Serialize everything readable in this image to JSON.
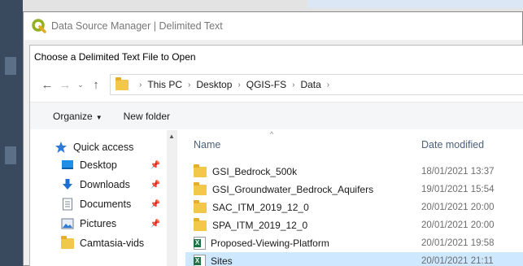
{
  "qgis_dialog": {
    "title": "Data Source Manager | Delimited Text"
  },
  "file_dialog": {
    "title": "Choose a Delimited Text File to Open",
    "breadcrumbs": [
      "This PC",
      "Desktop",
      "QGIS-FS",
      "Data"
    ],
    "toolbar": {
      "organize_label": "Organize",
      "new_folder_label": "New folder"
    },
    "nav_pane": {
      "items": [
        {
          "label": "Quick access",
          "icon": "star-icon"
        },
        {
          "label": "Desktop",
          "icon": "desktop-icon",
          "pinned": true
        },
        {
          "label": "Downloads",
          "icon": "download-icon",
          "pinned": true
        },
        {
          "label": "Documents",
          "icon": "document-icon",
          "pinned": true
        },
        {
          "label": "Pictures",
          "icon": "pictures-icon",
          "pinned": true
        },
        {
          "label": "Camtasia-vids",
          "icon": "folder-icon",
          "pinned": false
        }
      ]
    },
    "columns": {
      "name": "Name",
      "date_modified": "Date modified"
    },
    "files": [
      {
        "name": "GSI_Bedrock_500k",
        "date": "18/01/2021 13:37",
        "type": "folder"
      },
      {
        "name": "GSI_Groundwater_Bedrock_Aquifers",
        "date": "19/01/2021 15:54",
        "type": "folder"
      },
      {
        "name": "SAC_ITM_2019_12_0",
        "date": "20/01/2021 20:00",
        "type": "folder"
      },
      {
        "name": "SPA_ITM_2019_12_0",
        "date": "20/01/2021 20:00",
        "type": "folder"
      },
      {
        "name": "Proposed-Viewing-Platform",
        "date": "20/01/2021 19:58",
        "type": "excel"
      },
      {
        "name": "Sites",
        "date": "20/01/2021 21:11",
        "type": "excel",
        "selected": true
      }
    ]
  },
  "colors": {
    "selection": "#cde8ff",
    "folder": "#f2c84b",
    "qgis_green": "#93b023",
    "header_text": "#4c607a"
  }
}
